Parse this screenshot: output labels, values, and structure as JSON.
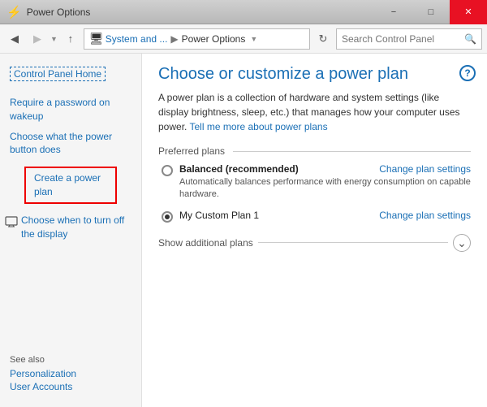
{
  "titlebar": {
    "title": "Power Options",
    "minimize_label": "−",
    "maximize_label": "□",
    "close_label": "✕",
    "icon": "⚙"
  },
  "navbar": {
    "back_label": "◀",
    "forward_label": "▶",
    "up_label": "↑",
    "breadcrumb": {
      "icon": "🖥",
      "path1": "System and ...",
      "sep1": "▶",
      "path2": "Power Options"
    },
    "refresh_label": "↻",
    "search_placeholder": "Search Control Panel",
    "search_icon": "🔍"
  },
  "sidebar": {
    "home_label": "Control Panel Home",
    "links": [
      {
        "id": "require-password",
        "label": "Require a password on wakeup"
      },
      {
        "id": "power-button",
        "label": "Choose what the power button does"
      },
      {
        "id": "create-plan",
        "label": "Create a power plan",
        "boxed": true
      },
      {
        "id": "turn-off",
        "label": "Choose when to turn off the display"
      }
    ],
    "see_also": {
      "label": "See also",
      "items": [
        {
          "id": "personalization",
          "label": "Personalization"
        },
        {
          "id": "user-accounts",
          "label": "User Accounts"
        }
      ]
    }
  },
  "content": {
    "title": "Choose or customize a power plan",
    "description": "A power plan is a collection of hardware and system settings (like display brightness, sleep, etc.) that manages how your computer uses power.",
    "tell_me_link": "Tell me more about power plans",
    "preferred_plans_label": "Preferred plans",
    "plans": [
      {
        "id": "balanced",
        "name": "Balanced (recommended)",
        "description": "Automatically balances performance with energy consumption on capable hardware.",
        "change_label": "Change plan settings",
        "selected": false
      },
      {
        "id": "custom",
        "name": "My Custom Plan 1",
        "description": "",
        "change_label": "Change plan settings",
        "selected": true
      }
    ],
    "show_additional_label": "Show additional plans",
    "expand_btn_label": "⌄",
    "help_label": "?"
  }
}
